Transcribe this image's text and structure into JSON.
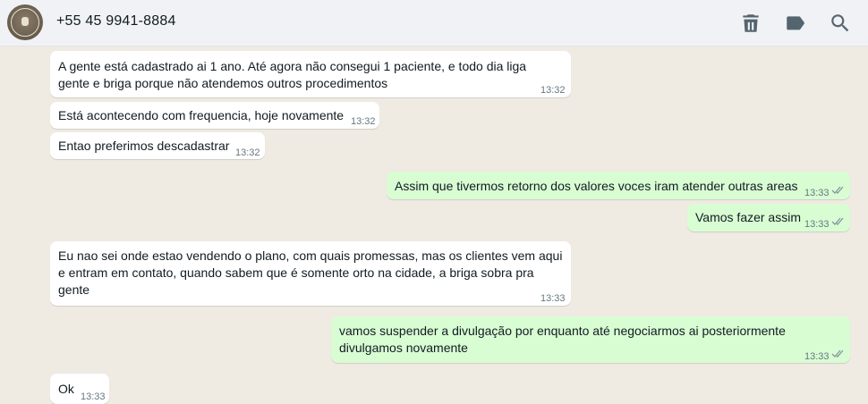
{
  "header": {
    "contact_name": "+55 45 9941-8884",
    "icons": [
      "trash-icon",
      "label-icon",
      "search-icon"
    ],
    "avatar": "contact-avatar"
  },
  "colors": {
    "incoming": "#ffffff",
    "outgoing": "#d9fdd3",
    "background": "#efeae2",
    "header": "#f0f2f5",
    "meta": "#667781"
  },
  "messages": [
    {
      "direction": "in",
      "lines": [
        "A gente está cadastrado ai 1 ano.  Até agora não consegui 1 paciente, e todo dia liga",
        "gente e briga porque não atendemos outros procedimentos"
      ],
      "time": "13:32"
    },
    {
      "direction": "in",
      "lines": [
        "Está acontecendo com frequencia, hoje novamente"
      ],
      "time": "13:32"
    },
    {
      "direction": "in",
      "lines": [
        "Entao preferimos descadastrar"
      ],
      "time": "13:32"
    },
    {
      "direction": "out",
      "lines": [
        "Assim que tivermos retorno dos valores voces iram atender outras areas"
      ],
      "time": "13:33"
    },
    {
      "direction": "out",
      "lines": [
        "Vamos fazer assim"
      ],
      "time": "13:33"
    },
    {
      "direction": "in",
      "lines": [
        "Eu nao sei onde estao vendendo o plano, com quais promessas, mas os clientes vem aqui",
        "e entram em contato, quando sabem que é somente orto na cidade, a briga sobra pra",
        "gente"
      ],
      "time": "13:33"
    },
    {
      "direction": "out",
      "lines": [
        "vamos suspender a divulgação por enquanto até negociarmos ai posteriormente",
        "divulgamos novamente"
      ],
      "time": "13:33"
    },
    {
      "direction": "in",
      "lines": [
        "Ok"
      ],
      "time": "13:33"
    }
  ]
}
